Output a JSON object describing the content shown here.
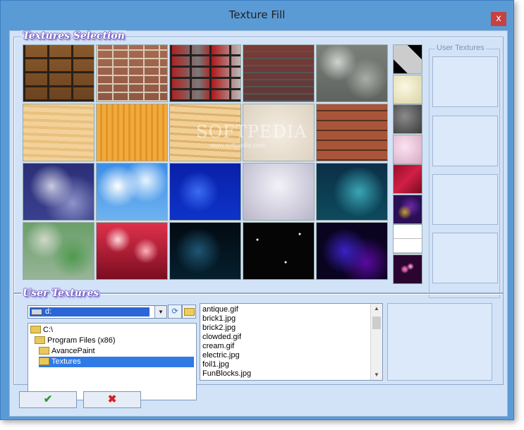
{
  "window": {
    "title": "Texture Fill",
    "close_icon": "close-icon",
    "close_glyph": "x"
  },
  "textures_section": {
    "caption": "Textures Selection",
    "textures": [
      {
        "name": "brick-dark"
      },
      {
        "name": "brick-beige"
      },
      {
        "name": "brick-red-gray"
      },
      {
        "name": "brick-weathered"
      },
      {
        "name": "stone-wall"
      },
      {
        "name": "wood-light"
      },
      {
        "name": "wood-orange"
      },
      {
        "name": "wood-pine"
      },
      {
        "name": "paper-cream"
      },
      {
        "name": "wood-planks"
      },
      {
        "name": "clouds-gray-blue"
      },
      {
        "name": "sky-clouds"
      },
      {
        "name": "water-blue"
      },
      {
        "name": "crumpled-paper"
      },
      {
        "name": "teal-smoke"
      },
      {
        "name": "green-camo"
      },
      {
        "name": "red-bokeh"
      },
      {
        "name": "space-nebula"
      },
      {
        "name": "stars-black"
      },
      {
        "name": "purple-plasma"
      }
    ],
    "small_textures": [
      {
        "name": "checker"
      },
      {
        "name": "cream-silk"
      },
      {
        "name": "gray-rock"
      },
      {
        "name": "pink-marble"
      },
      {
        "name": "red-diamond"
      },
      {
        "name": "purple-storm"
      },
      {
        "name": "white-grid"
      },
      {
        "name": "sparkle-purple"
      }
    ],
    "watermark": "SOFTPEDIA",
    "watermark_sub": "www.softpedia.com"
  },
  "user_textures_panel": {
    "caption": "User Textures",
    "slots": 4
  },
  "user_textures_section": {
    "caption": "User Textures",
    "drive_value": "d:",
    "refresh_icon": "refresh-icon",
    "open_folder_icon": "open-folder-icon",
    "tree": [
      {
        "label": "C:\\",
        "level": 0,
        "selected": false
      },
      {
        "label": "Program Files (x86)",
        "level": 1,
        "selected": false
      },
      {
        "label": "AvancePaint",
        "level": 2,
        "selected": false
      },
      {
        "label": "Textures",
        "level": 2,
        "selected": true
      }
    ],
    "files": [
      "antique.gif",
      "brick1.jpg",
      "brick2.jpg",
      "clowded.gif",
      "cream.gif",
      "electric.jpg",
      "foil1.jpg",
      "FunBlocks.jpg"
    ]
  },
  "buttons": {
    "ok_glyph": "✔",
    "ok_icon": "checkmark-icon",
    "ok_color": "#2e9a2e",
    "cancel_glyph": "✖",
    "cancel_icon": "cross-icon",
    "cancel_color": "#d22222"
  }
}
